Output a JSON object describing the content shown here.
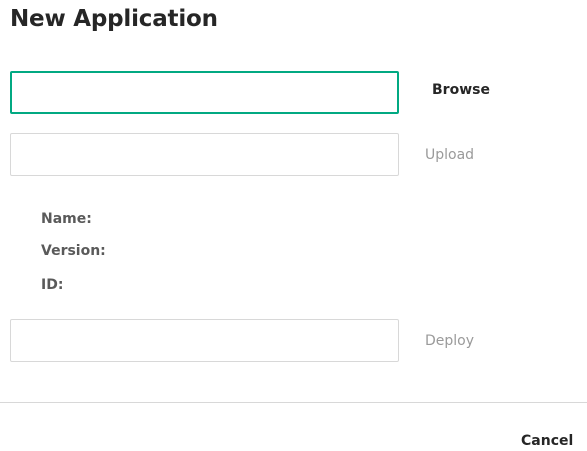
{
  "dialog": {
    "title": "New Application"
  },
  "file_input": {
    "value": "",
    "placeholder": ""
  },
  "browse_label": "Browse",
  "upload_input": {
    "value": "",
    "placeholder": ""
  },
  "upload_label": "Upload",
  "info": {
    "name_label": "Name:",
    "version_label": "Version:",
    "id_label": "ID:"
  },
  "deploy_input": {
    "value": "",
    "placeholder": ""
  },
  "deploy_label": "Deploy",
  "cancel_label": "Cancel",
  "colors": {
    "focus_border": "#01a982",
    "text": "#262626",
    "disabled_text": "#9a9a9a",
    "border": "#d8d8d8"
  }
}
